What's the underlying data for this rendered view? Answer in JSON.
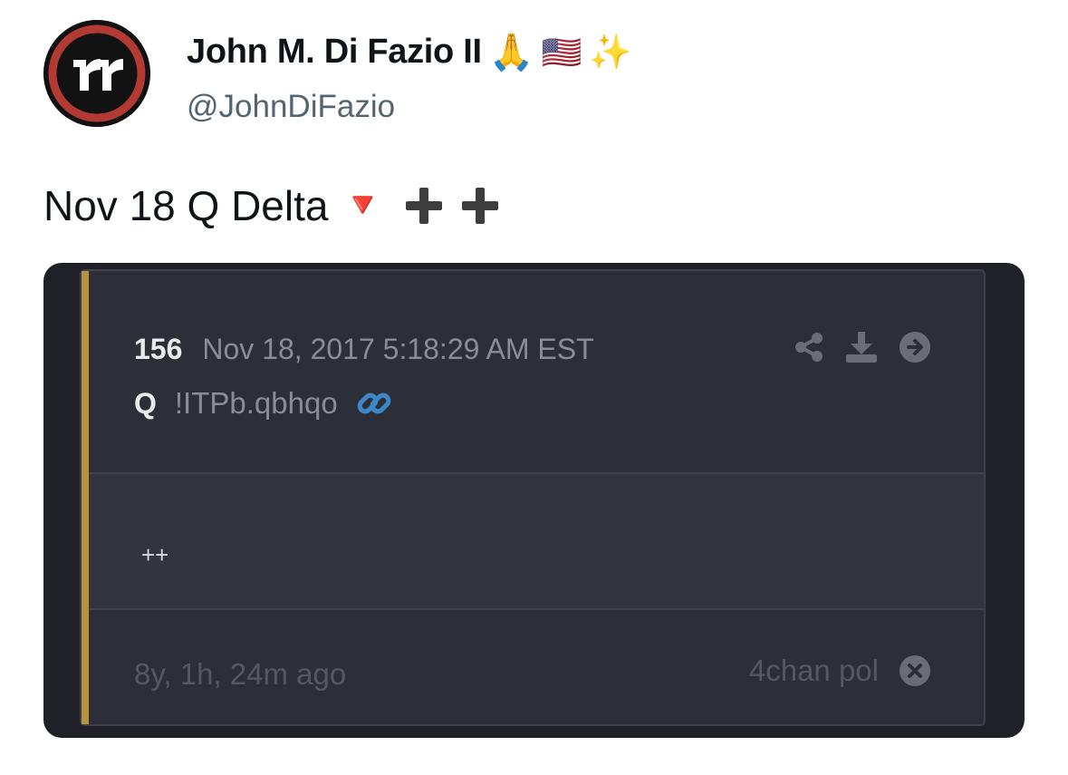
{
  "header": {
    "display_name": "John M. Di Fazio II",
    "name_emojis": [
      "🙏",
      "🇺🇸",
      "✨"
    ],
    "handle": "@JohnDiFazio",
    "avatar_icon": "avatar-logo-icon"
  },
  "tweet": {
    "text": "Nov 18 Q Delta",
    "emoji_triangle": "🔻",
    "plus_icons": [
      "heavy-plus-icon",
      "heavy-plus-icon"
    ]
  },
  "card": {
    "post_number": "156",
    "post_date": "Nov 18, 2017 5:18:29 AM EST",
    "author": "Q",
    "tripcode": "!ITPb.qbhqo",
    "body": "++",
    "ago": "8y, 1h, 24m ago",
    "source": "4chan pol",
    "icons": [
      "share-icon",
      "download-icon",
      "arrow-right-circle-icon",
      "link-icon",
      "close-circle-icon"
    ],
    "colors": {
      "accent_bar": "#b8933e",
      "background": "#1f2126",
      "panel": "#2d2f38"
    }
  }
}
